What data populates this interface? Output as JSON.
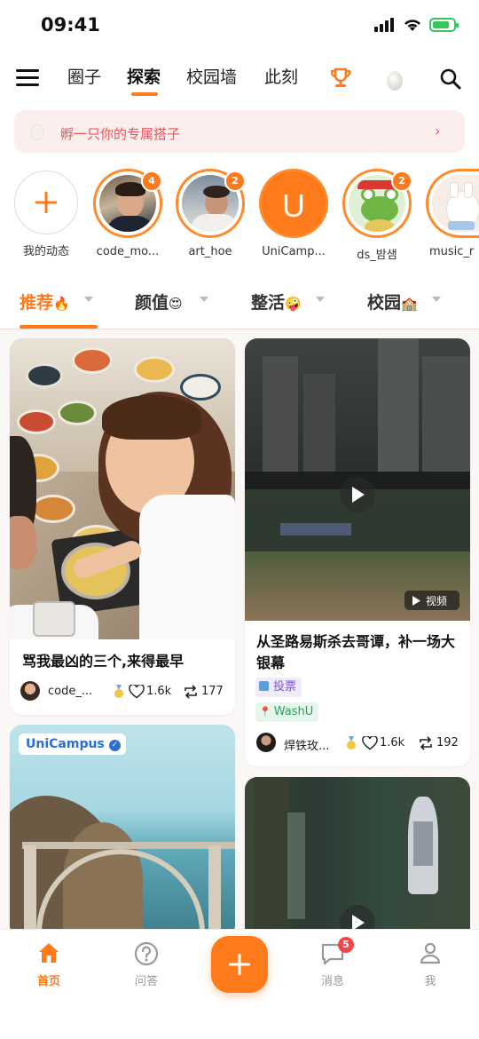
{
  "status_bar": {
    "time": "09:41"
  },
  "top_nav": {
    "tabs": [
      {
        "label": "圈子"
      },
      {
        "label": "探索",
        "active": true
      },
      {
        "label": "校园墙"
      },
      {
        "label": "此刻"
      }
    ],
    "icons": [
      "menu-icon",
      "trophy-icon",
      "egg-icon",
      "search-icon"
    ]
  },
  "banner": {
    "text": "孵一只你的专属搭子",
    "icon": "egg-icon",
    "arrow": "›"
  },
  "stories": [
    {
      "label": "我的动态",
      "type": "add"
    },
    {
      "label": "code_mo...",
      "badge": "4"
    },
    {
      "label": "art_hoe",
      "badge": "2"
    },
    {
      "label": "UniCamp...",
      "initial": "U"
    },
    {
      "label": "ds_밤샘",
      "badge": "2"
    },
    {
      "label": "music_r"
    }
  ],
  "categories": [
    {
      "label": "推荐",
      "emoji": "🔥",
      "active": true
    },
    {
      "label": "颜值",
      "emoji": "😍"
    },
    {
      "label": "整活",
      "emoji": "🤪"
    },
    {
      "label": "校园",
      "emoji": "🏫"
    }
  ],
  "feed": {
    "card1": {
      "title": "骂我最凶的三个,来得最早",
      "author": "code_...",
      "likes": "1.6k",
      "reposts": "177"
    },
    "card2": {
      "video_label": "视频",
      "title": "从圣路易斯杀去哥谭，补一场大银幕",
      "tag_vote": "投票",
      "tag_location": "WashU",
      "author": "焊铁玫...",
      "likes": "1.6k",
      "reposts": "192"
    },
    "card3": {
      "brand": "UniCampus"
    }
  },
  "bottom_tabs": {
    "home": "首页",
    "qa": "问答",
    "messages": "消息",
    "messages_badge": "5",
    "me": "我"
  },
  "colors": {
    "accent": "#ff7a1a",
    "banner_text": "#e8545b",
    "badge": "#f04848"
  }
}
